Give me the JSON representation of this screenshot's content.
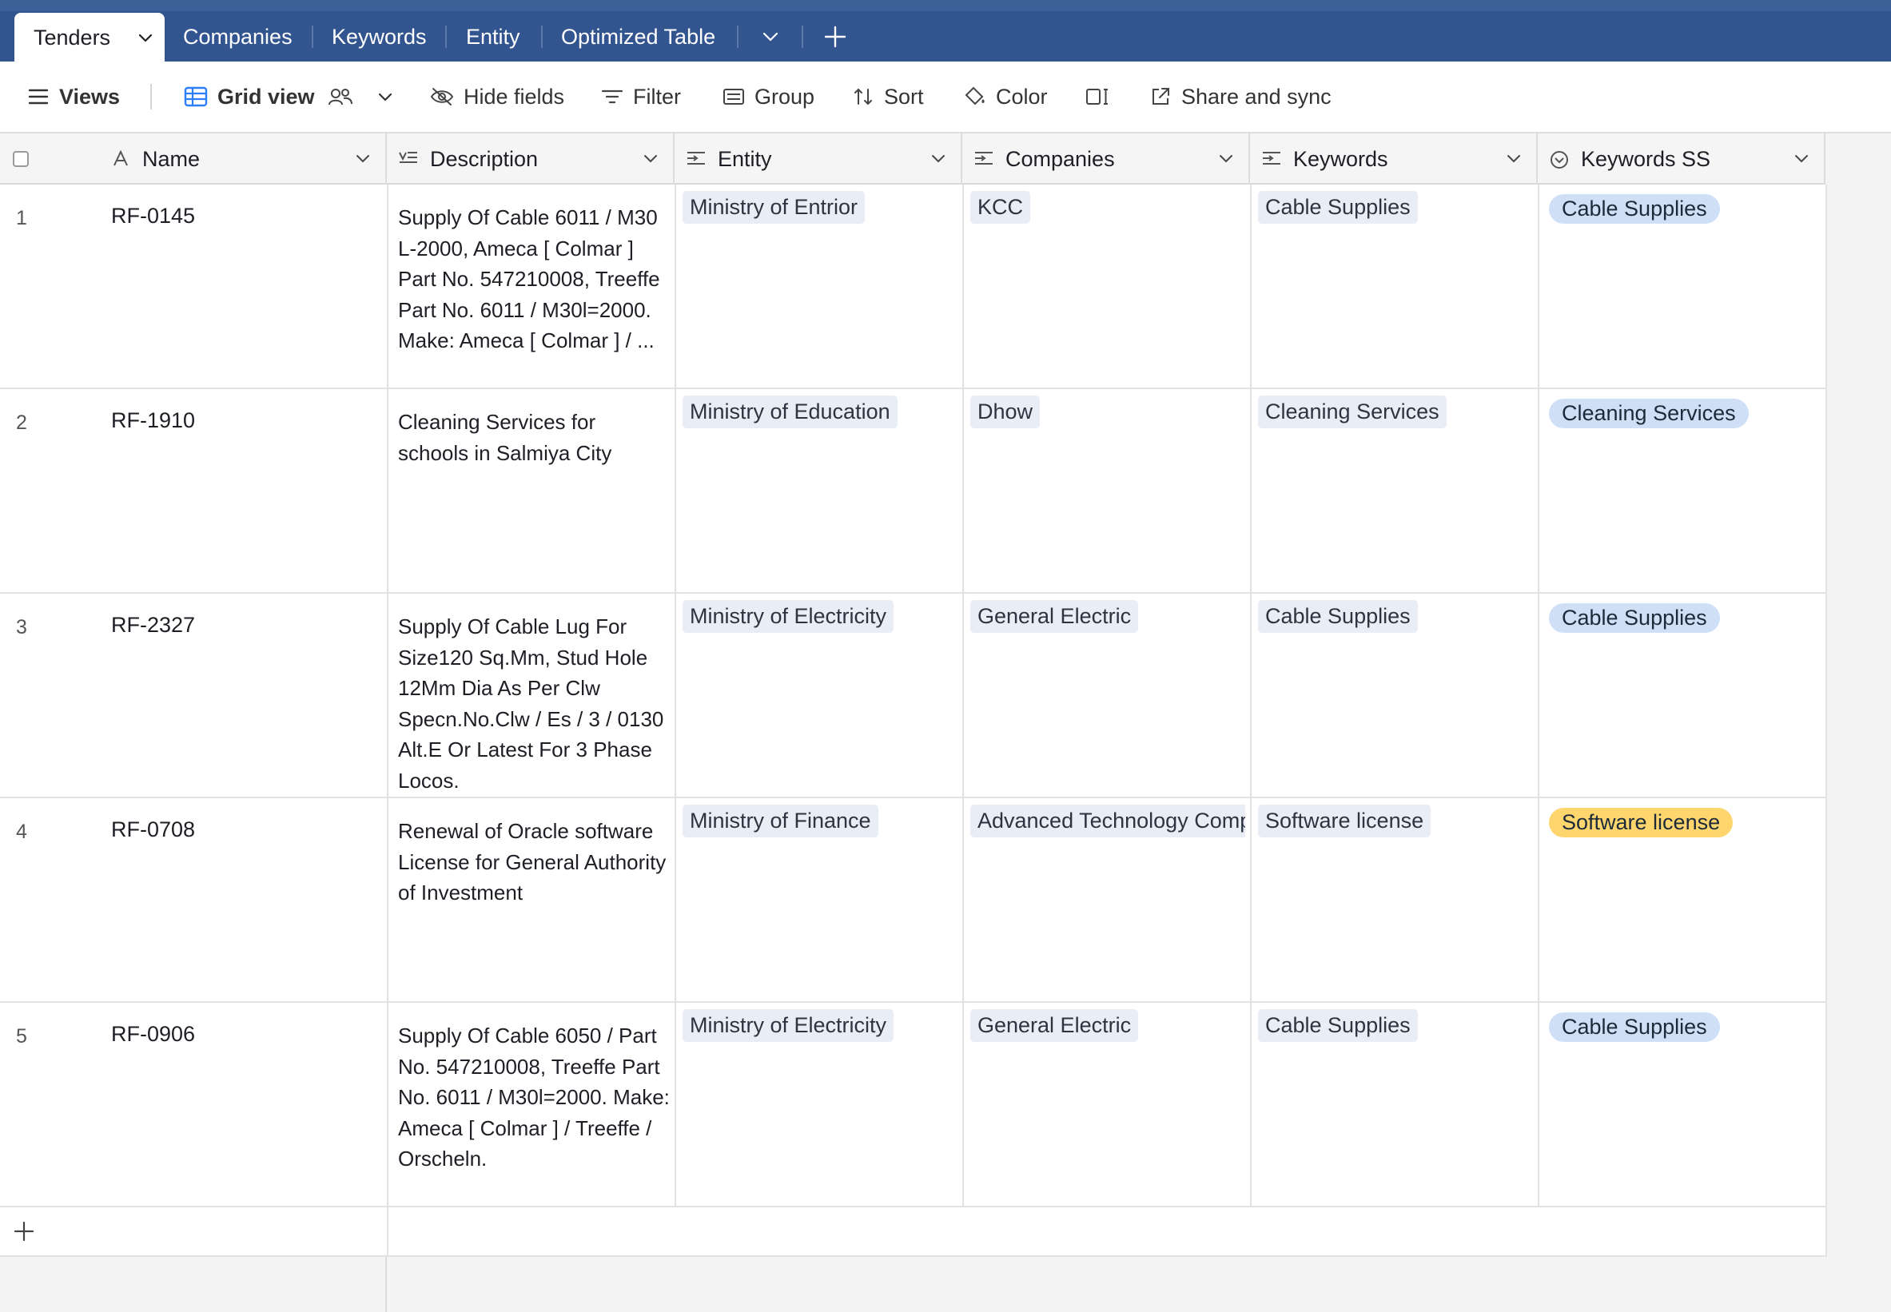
{
  "tabs": {
    "active": "Tenders",
    "items": [
      "Companies",
      "Keywords",
      "Entity",
      "Optimized Table"
    ]
  },
  "toolbar": {
    "views": "Views",
    "grid_view": "Grid view",
    "hide_fields": "Hide fields",
    "filter": "Filter",
    "group": "Group",
    "sort": "Sort",
    "color": "Color",
    "share": "Share and sync"
  },
  "columns": [
    "Name",
    "Description",
    "Entity",
    "Companies",
    "Keywords",
    "Keywords SS"
  ],
  "rows": [
    {
      "num": "1",
      "name": "RF-0145",
      "description": "Supply Of Cable 6011 / M30 L-2000, Ameca [ Colmar ] Part No. 547210008, Treeffe Part No. 6011 / M30l=2000. Make: Ameca [ Colmar ] / ...",
      "entity": "Ministry of Entrior",
      "company": "KCC",
      "keyword": "Cable Supplies",
      "keyword_ss": "Cable Supplies"
    },
    {
      "num": "2",
      "name": "RF-1910",
      "description": "Cleaning Services for schools in Salmiya City",
      "entity": "Ministry of Education",
      "company": "Dhow",
      "keyword": "Cleaning Services",
      "keyword_ss": "Cleaning Services"
    },
    {
      "num": "3",
      "name": "RF-2327",
      "description": "Supply Of Cable Lug For Size120 Sq.Mm, Stud Hole 12Mm Dia As Per Clw Specn.No.Clw / Es / 3 / 0130 Alt.E Or Latest For 3 Phase Locos.",
      "entity": "Ministry of Electricity",
      "company": "General Electric",
      "keyword": "Cable Supplies",
      "keyword_ss": "Cable Supplies"
    },
    {
      "num": "4",
      "name": "RF-0708",
      "description": "Renewal of Oracle software License for General Authority of Investment",
      "entity": "Ministry of Finance",
      "company": "Advanced Technology Comp",
      "keyword": "Software license",
      "keyword_ss": "Software license"
    },
    {
      "num": "5",
      "name": "RF-0906",
      "description": "Supply Of Cable 6050 / Part No. 547210008, Treeffe Part No. 6011 / M30l=2000. Make: Ameca [ Colmar ] / Treeffe / Orscheln.",
      "entity": "Ministry of Electricity",
      "company": "General Electric",
      "keyword": "Cable Supplies",
      "keyword_ss": "Cable Supplies"
    }
  ],
  "colors": {
    "tabbar": "#325590",
    "pill": "#e9eef6",
    "chip_blue": "#cfdff5",
    "chip_yellow": "#ffd66e"
  }
}
